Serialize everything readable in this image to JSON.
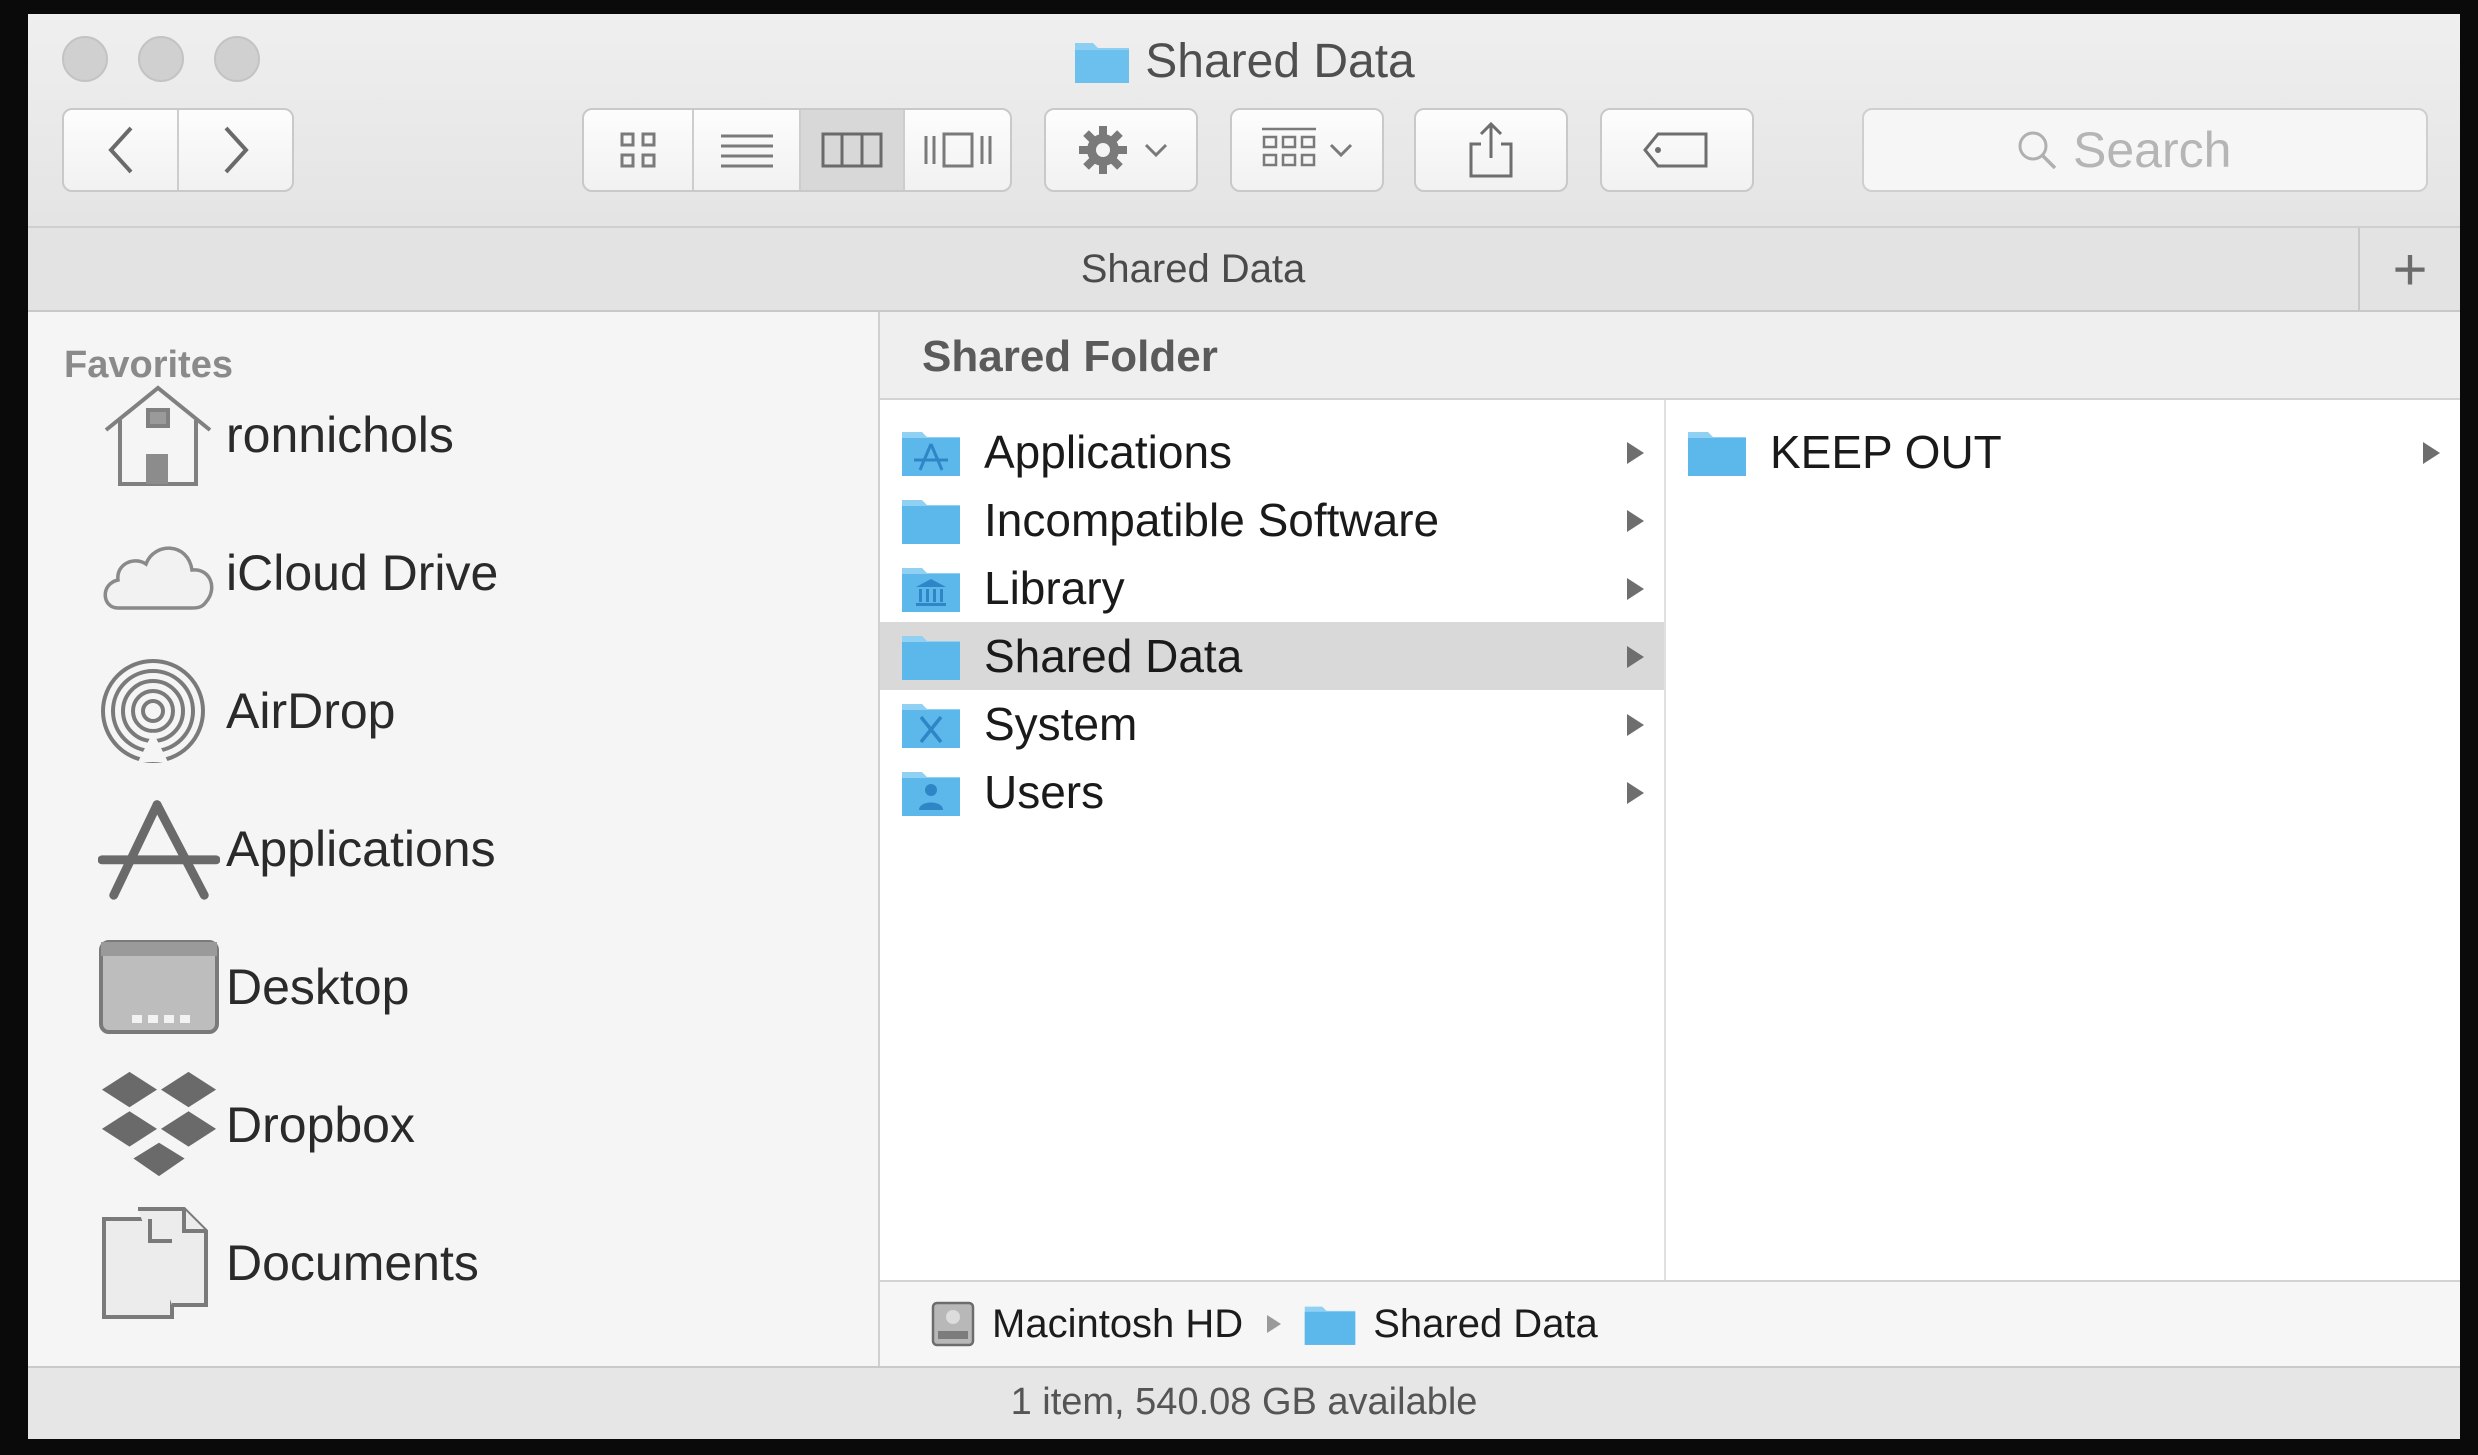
{
  "window": {
    "title": "Shared Data"
  },
  "toolbar": {
    "back_icon": "chevron-left-icon",
    "forward_icon": "chevron-right-icon",
    "view_modes": [
      "icon-view",
      "list-view",
      "column-view",
      "cover-flow-view"
    ],
    "active_view": "column-view",
    "action_icon": "gear-icon",
    "arrange_icon": "arrange-grid-icon",
    "share_icon": "share-icon",
    "tag_icon": "tag-icon",
    "search_placeholder": "Search"
  },
  "tabbar": {
    "label": "Shared Data",
    "add_label": "+"
  },
  "sidebar": {
    "heading": "Favorites",
    "items": [
      {
        "label": "ronnichols",
        "icon": "home-icon"
      },
      {
        "label": "iCloud Drive",
        "icon": "cloud-icon"
      },
      {
        "label": "AirDrop",
        "icon": "airdrop-icon"
      },
      {
        "label": "Applications",
        "icon": "applications-icon"
      },
      {
        "label": "Desktop",
        "icon": "desktop-icon"
      },
      {
        "label": "Dropbox",
        "icon": "dropbox-icon"
      },
      {
        "label": "Documents",
        "icon": "documents-icon"
      }
    ]
  },
  "content": {
    "header": "Shared Folder",
    "column1": [
      {
        "label": "Applications",
        "icon": "applications-folder-icon",
        "selected": false
      },
      {
        "label": "Incompatible Software",
        "icon": "folder-icon",
        "selected": false
      },
      {
        "label": "Library",
        "icon": "library-folder-icon",
        "selected": false
      },
      {
        "label": "Shared Data",
        "icon": "folder-icon",
        "selected": true
      },
      {
        "label": "System",
        "icon": "system-folder-icon",
        "selected": false
      },
      {
        "label": "Users",
        "icon": "users-folder-icon",
        "selected": false
      }
    ],
    "column2": [
      {
        "label": "KEEP OUT",
        "icon": "folder-icon"
      }
    ]
  },
  "pathbar": {
    "crumbs": [
      {
        "label": "Macintosh HD",
        "icon": "hard-drive-icon"
      },
      {
        "label": "Shared Data",
        "icon": "folder-icon"
      }
    ]
  },
  "status": {
    "text": "1 item, 540.08 GB available"
  },
  "colors": {
    "folder_blue": "#5cb8ea",
    "selection_gray": "#d9d9d9",
    "sidebar_bg": "#f5f5f5"
  }
}
